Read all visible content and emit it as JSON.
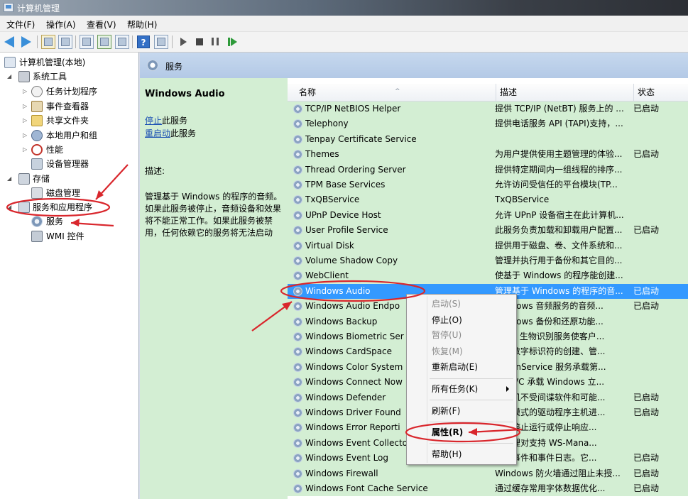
{
  "window": {
    "title": "计算机管理"
  },
  "menu": [
    {
      "label": "文件(F)"
    },
    {
      "label": "操作(A)"
    },
    {
      "label": "查看(V)"
    },
    {
      "label": "帮助(H)"
    }
  ],
  "tree": {
    "root": "计算机管理(本地)",
    "items": [
      {
        "label": "系统工具",
        "icon": "tools-icon"
      },
      {
        "label": "任务计划程序",
        "icon": "clock-icon"
      },
      {
        "label": "事件查看器",
        "icon": "event-viewer-icon"
      },
      {
        "label": "共享文件夹",
        "icon": "shared-folder-icon"
      },
      {
        "label": "本地用户和组",
        "icon": "users-icon"
      },
      {
        "label": "性能",
        "icon": "performance-icon"
      },
      {
        "label": "设备管理器",
        "icon": "device-manager-icon"
      },
      {
        "label": "存储",
        "icon": "storage-icon"
      },
      {
        "label": "磁盘管理",
        "icon": "disk-icon"
      },
      {
        "label": "服务和应用程序",
        "icon": "services-apps-icon"
      },
      {
        "label": "服务",
        "icon": "gear-icon"
      },
      {
        "label": "WMI 控件",
        "icon": "wmi-icon"
      }
    ]
  },
  "header": {
    "title": "服务"
  },
  "detail": {
    "service_name": "Windows Audio",
    "stop_link": "停止",
    "stop_suffix": "此服务",
    "restart_link": "重启动",
    "restart_suffix": "此服务",
    "desc_label": "描述:",
    "desc_text": "管理基于 Windows 的程序的音频。如果此服务被停止，音频设备和效果将不能正常工作。如果此服务被禁用，任何依赖它的服务将无法启动"
  },
  "table": {
    "columns": [
      "名称",
      "描述",
      "状态"
    ],
    "rows": [
      {
        "name": "TCP/IP NetBIOS Helper",
        "desc": "提供 TCP/IP (NetBT) 服务上的 ...",
        "status": "已启动"
      },
      {
        "name": "Telephony",
        "desc": "提供电话服务 API (TAPI)支持，...",
        "status": ""
      },
      {
        "name": "Tenpay Certificate Service",
        "desc": "",
        "status": ""
      },
      {
        "name": "Themes",
        "desc": "为用户提供使用主题管理的体验...",
        "status": "已启动"
      },
      {
        "name": "Thread Ordering Server",
        "desc": "提供特定期间内一组线程的排序...",
        "status": ""
      },
      {
        "name": "TPM Base Services",
        "desc": "允许访问受信任的平台模块(TP...",
        "status": ""
      },
      {
        "name": "TxQBService",
        "desc": "TxQBService",
        "status": ""
      },
      {
        "name": "UPnP Device Host",
        "desc": "允许 UPnP 设备宿主在此计算机...",
        "status": ""
      },
      {
        "name": "User Profile Service",
        "desc": "此服务负责加载和卸载用户配置...",
        "status": "已启动"
      },
      {
        "name": "Virtual Disk",
        "desc": "提供用于磁盘、卷、文件系统和...",
        "status": ""
      },
      {
        "name": "Volume Shadow Copy",
        "desc": "管理并执行用于备份和其它目的...",
        "status": ""
      },
      {
        "name": "WebClient",
        "desc": "使基于 Windows 的程序能创建...",
        "status": ""
      },
      {
        "name": "Windows Audio",
        "desc": "管理基于 Windows 的程序的音...",
        "status": "已启动",
        "selected": true
      },
      {
        "name": "Windows Audio Endpo",
        "desc": "Windows 音频服务的音频...",
        "status": "已启动"
      },
      {
        "name": "Windows Backup",
        "desc": "Windows 备份和还原功能...",
        "status": ""
      },
      {
        "name": "Windows Biometric Ser",
        "desc": "dows 生物识别服务使客户...",
        "status": ""
      },
      {
        "name": "Windows CardSpace",
        "desc": "启用数字标识符的创建、管...",
        "status": ""
      },
      {
        "name": "Windows Color System",
        "desc": "PlugInService 服务承载第...",
        "status": ""
      },
      {
        "name": "Windows Connect Now",
        "desc": "NCSVC 承载 Windows 立...",
        "status": ""
      },
      {
        "name": "Windows Defender",
        "desc": "计算机不受间谍软件和可能...",
        "status": "已启动"
      },
      {
        "name": "Windows Driver Found",
        "desc": "用户模式的驱动程序主机进...",
        "status": "已启动"
      },
      {
        "name": "Windows Error Reporti",
        "desc": "程序停止运行或停止响应...",
        "status": ""
      },
      {
        "name": "Windows Event Collecto",
        "desc": "将管理对支持 WS-Mana...",
        "status": ""
      },
      {
        "name": "Windows Event Log",
        "desc": "管理事件和事件日志。它...",
        "status": "已启动"
      },
      {
        "name": "Windows Firewall",
        "desc": "Windows 防火墙通过阻止未授...",
        "status": "已启动"
      },
      {
        "name": "Windows Font Cache Service",
        "desc": "通过缓存常用字体数据优化...",
        "status": "已启动"
      }
    ]
  },
  "context_menu": [
    {
      "label": "启动(S)",
      "disabled": true
    },
    {
      "label": "停止(O)"
    },
    {
      "label": "暂停(U)",
      "disabled": true
    },
    {
      "label": "恢复(M)",
      "disabled": true
    },
    {
      "label": "重新启动(E)"
    },
    {
      "label": "所有任务(K)"
    },
    {
      "label": "刷新(F)"
    },
    {
      "label": "属性(R)",
      "bold": true
    },
    {
      "label": "帮助(H)"
    }
  ],
  "colors": {
    "selection": "#3399ff",
    "row_bg": "#d3eed3",
    "annotation": "#d9262c"
  }
}
